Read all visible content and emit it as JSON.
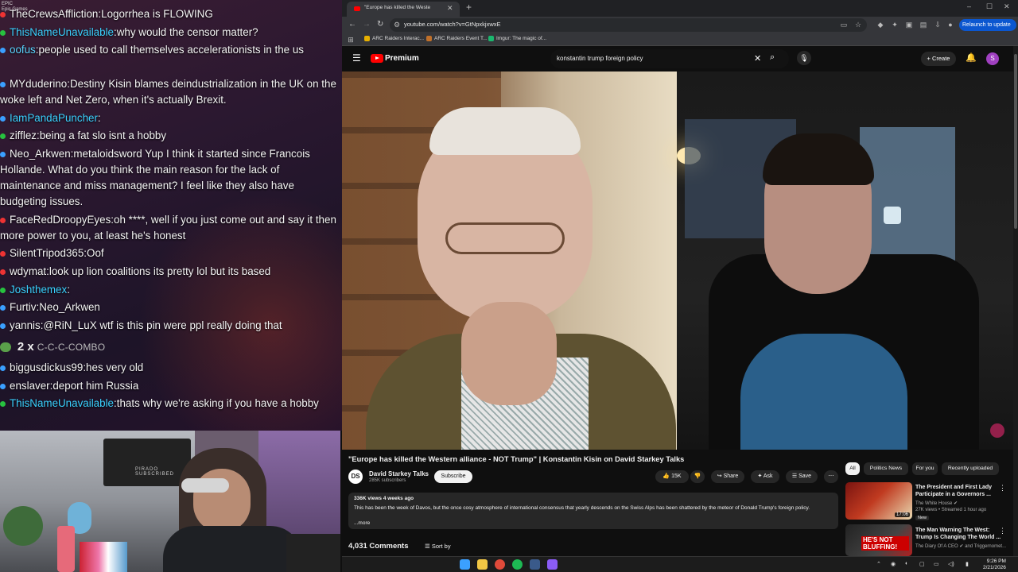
{
  "chat": {
    "brand": "Epic Games",
    "messages": [
      {
        "user": "TheCrewsAffliction",
        "text": "Logorrhea is FLOWING",
        "color": "#f4f4f4",
        "dot": "#e33"
      },
      {
        "user": "ThisNameUnavailable",
        "text": "why would the censor matter?",
        "color": "#3ad1ff",
        "dot": "#27c23f"
      },
      {
        "user": "oofus",
        "text": "people used to call themselves accelerationists in the us",
        "color": "#5ad5ff",
        "dot": "#3aa0ff"
      },
      {
        "user": "MYduderino",
        "text": "Destiny Kisin blames deindustrialization in the UK on the woke left and Net Zero, when it's actually Brexit.",
        "color": "#f4f4f4",
        "dot": "#3aa0ff"
      },
      {
        "user": "IamPandaPuncher",
        "text": "",
        "color": "#3ad1ff",
        "dot": "#3aa0ff"
      },
      {
        "user": "zifflez",
        "text": "being a fat slo isnt a hobby",
        "color": "#f4f4f4",
        "dot": "#27c23f"
      },
      {
        "user": "Neo_Arkwen",
        "text": "metaloidsword Yup  I think it started since Francois Hollande. What do you think the main reason for the lack of maintenance and miss management? I feel like they also have budgeting issues.",
        "color": "#f4f4f4",
        "dot": "#3aa0ff"
      },
      {
        "user": "FaceRedDroopyEyes",
        "text": "oh ****, well if you just come out and say it then more power to you, at least he's honest",
        "color": "#f4f4f4",
        "dot": "#e33"
      },
      {
        "user": "SilentTripod365",
        "text": "Oof",
        "color": "#f4f4f4",
        "dot": "#e33"
      },
      {
        "user": "wdymat",
        "text": "look up lion coalitions its pretty lol but its based",
        "color": "#f4f4f4",
        "dot": "#e33"
      },
      {
        "user": "Joshthemex",
        "text": "",
        "color": "#3ad1ff",
        "dot": "#27c23f"
      },
      {
        "user": "Furtiv",
        "text": "Neo_Arkwen",
        "color": "#f4f4f4",
        "dot": "#3aa0ff"
      },
      {
        "user": "yannis",
        "text": "@RiN_LuX wtf is this pin  were ppl really doing that",
        "color": "#f4f4f4",
        "dot": "#3aa0ff"
      },
      {
        "user": "biggusdickus99",
        "text": "hes very old",
        "color": "#f4f4f4",
        "dot": "#3aa0ff"
      },
      {
        "user": "enslaver",
        "text": "deport him Russia",
        "color": "#f4f4f4",
        "dot": "#3aa0ff"
      },
      {
        "user": "ThisNameUnavailable",
        "text": "thats why we're asking if you have a hobby",
        "color": "#3ad1ff",
        "dot": "#27c23f"
      }
    ],
    "combo_count": "2 x",
    "combo_label": "C-C-C-COMBO"
  },
  "webcam": {
    "wall_label": "PIRADO SUBSCRIBED"
  },
  "browser": {
    "tab_title": "\"Europe has killed the Weste",
    "url": "youtube.com/watch?v=GtNpxkjxwxE",
    "relaunch": "Relaunch to update",
    "bookmarks": [
      "ARC Raiders Interac...",
      "ARC Raiders Event T...",
      "Imgur: The magic of..."
    ]
  },
  "youtube": {
    "brand": "Premium",
    "search_query": "konstantin trump foreign policy",
    "create_label": "Create",
    "avatar_letter": "S",
    "video_title": "\"Europe has killed the Western alliance - NOT Trump\" | Konstantin Kisin on David Starkey Talks",
    "channel": {
      "avatar_text": "DS",
      "name": "David Starkey Talks",
      "subs": "285K subscribers",
      "subscribe": "Subscribe"
    },
    "actions": {
      "likes": "15K",
      "share": "Share",
      "ask": "Ask",
      "save": "Save"
    },
    "description": {
      "meta": "336K views  4 weeks ago",
      "text": "This has been the week of Davos, but the once cosy atmosphere of international consensus that yearly descends on the Swiss Alps has been shattered by the meteor of Donald Trump's foreign policy.",
      "more": "...more"
    },
    "comments_count": "4,031 Comments",
    "sort_by": "Sort by",
    "chips": [
      "All",
      "Politics News",
      "For you",
      "Recently uploaded"
    ],
    "recommendations": [
      {
        "title": "The President and First Lady Participate in a Governors ...",
        "channel": "The White House",
        "meta": "27K views • Streamed 1 hour ago",
        "badge": "New",
        "duration": "17:06"
      },
      {
        "title": "The Man Warning The West: Trump Is Changing The World ...",
        "channel": "The Diary Of A CEO",
        "meta": "",
        "badge": "",
        "duration": "",
        "thumb_text": "HE'S NOT BLUFFING!"
      }
    ],
    "rec2_channel_extra": "and Triggernomet..."
  },
  "taskbar": {
    "time": "9:26 PM",
    "date": "2/21/2026"
  }
}
